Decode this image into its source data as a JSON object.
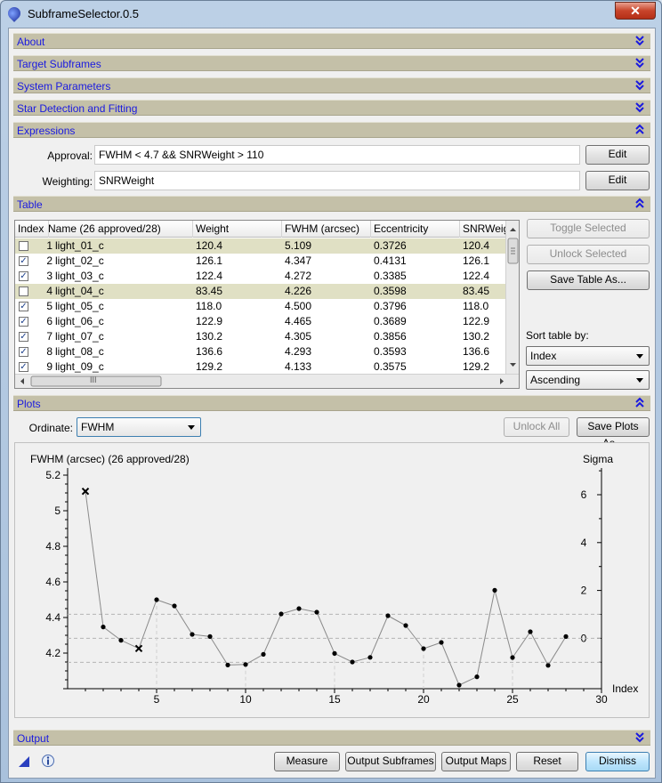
{
  "window": {
    "title": "SubframeSelector.0.5",
    "close_label": "✕"
  },
  "sections": {
    "about": "About",
    "target": "Target Subframes",
    "system": "System Parameters",
    "stars": "Star Detection and Fitting",
    "expressions": "Expressions",
    "table": "Table",
    "plots": "Plots",
    "output": "Output"
  },
  "expressions": {
    "approval_label": "Approval:",
    "approval_value": "FWHM < 4.7 && SNRWeight > 110",
    "weighting_label": "Weighting:",
    "weighting_value": "SNRWeight",
    "edit_label": "Edit"
  },
  "table": {
    "headers": [
      "Index",
      "Name (26 approved/28)",
      "Weight",
      "FWHM (arcsec)",
      "Eccentricity",
      "SNRWeig"
    ],
    "rows": [
      {
        "checked": false,
        "index": "1",
        "name": "light_01_c",
        "weight": "120.4",
        "fwhm": "5.109",
        "ecc": "0.3726",
        "snr": "120.4",
        "selected": true
      },
      {
        "checked": true,
        "index": "2",
        "name": "light_02_c",
        "weight": "126.1",
        "fwhm": "4.347",
        "ecc": "0.4131",
        "snr": "126.1",
        "selected": false
      },
      {
        "checked": true,
        "index": "3",
        "name": "light_03_c",
        "weight": "122.4",
        "fwhm": "4.272",
        "ecc": "0.3385",
        "snr": "122.4",
        "selected": false
      },
      {
        "checked": false,
        "index": "4",
        "name": "light_04_c",
        "weight": "83.45",
        "fwhm": "4.226",
        "ecc": "0.3598",
        "snr": "83.45",
        "selected": true
      },
      {
        "checked": true,
        "index": "5",
        "name": "light_05_c",
        "weight": "118.0",
        "fwhm": "4.500",
        "ecc": "0.3796",
        "snr": "118.0",
        "selected": false
      },
      {
        "checked": true,
        "index": "6",
        "name": "light_06_c",
        "weight": "122.9",
        "fwhm": "4.465",
        "ecc": "0.3689",
        "snr": "122.9",
        "selected": false
      },
      {
        "checked": true,
        "index": "7",
        "name": "light_07_c",
        "weight": "130.2",
        "fwhm": "4.305",
        "ecc": "0.3856",
        "snr": "130.2",
        "selected": false
      },
      {
        "checked": true,
        "index": "8",
        "name": "light_08_c",
        "weight": "136.6",
        "fwhm": "4.293",
        "ecc": "0.3593",
        "snr": "136.6",
        "selected": false
      },
      {
        "checked": true,
        "index": "9",
        "name": "light_09_c",
        "weight": "129.2",
        "fwhm": "4.133",
        "ecc": "0.3575",
        "snr": "129.2",
        "selected": false
      }
    ],
    "hscroll_grip": "III",
    "toggle_selected": "Toggle Selected",
    "unlock_selected": "Unlock Selected",
    "save_table": "Save Table As...",
    "sort_label": "Sort table by:",
    "sort_by": "Index",
    "sort_order": "Ascending"
  },
  "plots": {
    "ordinate_label": "Ordinate:",
    "ordinate_value": "FWHM",
    "unlock_all": "Unlock All",
    "save_plots": "Save Plots As..."
  },
  "chart_data": {
    "type": "line",
    "title": "FWHM (arcsec) (26 approved/28)",
    "xlabel": "Index",
    "ylabel_right": "Sigma",
    "xlim": [
      0,
      30
    ],
    "ylim": [
      4.0,
      5.2
    ],
    "x_ticks": [
      5,
      10,
      15,
      20,
      25,
      30
    ],
    "y_ticks": [
      4.2,
      4.4,
      4.6,
      4.8,
      5.0,
      5.2
    ],
    "sigma_ticks": [
      0,
      2,
      4,
      6
    ],
    "sigma_per_unit": 0.1345,
    "sigma_lines": [
      4.283,
      4.418,
      4.148
    ],
    "x": [
      1,
      2,
      3,
      4,
      5,
      6,
      7,
      8,
      9,
      10,
      11,
      12,
      13,
      14,
      15,
      16,
      17,
      18,
      19,
      20,
      21,
      22,
      23,
      24,
      25,
      26,
      27,
      28
    ],
    "fwhm": [
      5.109,
      4.347,
      4.272,
      4.226,
      4.5,
      4.465,
      4.305,
      4.293,
      4.133,
      4.136,
      4.193,
      4.42,
      4.45,
      4.43,
      4.198,
      4.15,
      4.176,
      4.41,
      4.355,
      4.225,
      4.26,
      4.02,
      4.067,
      4.553,
      4.175,
      4.32,
      4.131,
      4.293
    ],
    "rejected": [
      1,
      4
    ]
  },
  "footer": {
    "measure": "Measure",
    "output_subframes": "Output Subframes",
    "output_maps": "Output Maps",
    "reset": "Reset",
    "dismiss": "Dismiss"
  }
}
